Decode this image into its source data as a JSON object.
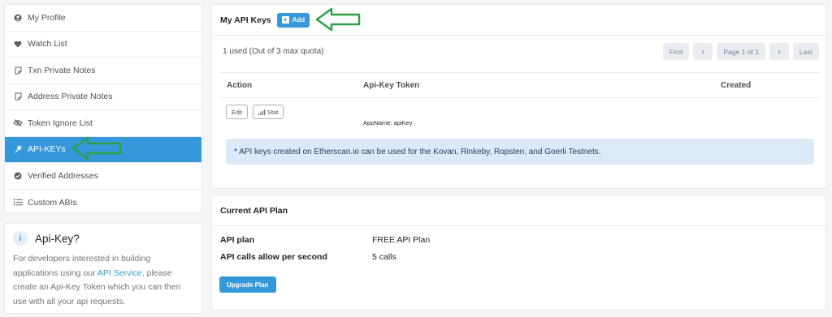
{
  "sidebar": {
    "items": [
      {
        "label": "My Profile",
        "icon": "user-circle-icon"
      },
      {
        "label": "Watch List",
        "icon": "heart-icon"
      },
      {
        "label": "Txn Private Notes",
        "icon": "note-icon"
      },
      {
        "label": "Address Private Notes",
        "icon": "note-icon"
      },
      {
        "label": "Token Ignore List",
        "icon": "eye-slash-icon"
      },
      {
        "label": "API-KEYs",
        "icon": "key-icon",
        "active": true
      },
      {
        "label": "Verified Addresses",
        "icon": "check-badge-icon"
      },
      {
        "label": "Custom ABIs",
        "icon": "list-icon"
      }
    ]
  },
  "info": {
    "icon": "i",
    "title": "Api-Key?",
    "text_before": "For developers interested in building applications using our ",
    "link": "API Service",
    "text_after": ", please create an Api-Key Token which you can then use with all your api requests."
  },
  "api_keys": {
    "title": "My API Keys",
    "add_label": "Add",
    "quota": "1 used (Out of 3 max quota)",
    "pager": {
      "first": "First",
      "prev": "‹",
      "page": "Page 1 of 1",
      "next": "›",
      "last": "Last"
    },
    "columns": [
      "Action",
      "Api-Key Token",
      "Created"
    ],
    "rows": [
      {
        "edit": "Edit",
        "stat": "Stat",
        "appname": "AppName: apiKey"
      }
    ],
    "note": "* API keys created on Etherscan.io can be used for the Kovan, Rinkeby, Ropsten, and Goerli Testnets."
  },
  "plan": {
    "title": "Current API Plan",
    "rows": [
      {
        "key": "API plan",
        "value": "FREE API Plan"
      },
      {
        "key": "API calls allow per second",
        "value": "5 calls"
      }
    ],
    "upgrade_label": "Upgrade Plan"
  },
  "colors": {
    "accent": "#3498db",
    "arrow": "#2ea043"
  }
}
